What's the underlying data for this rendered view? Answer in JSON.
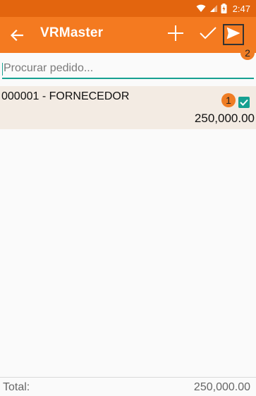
{
  "status_bar": {
    "time": "2:47",
    "icons": [
      "wifi-icon",
      "signal-icon",
      "battery-charging-icon"
    ]
  },
  "app_bar": {
    "title": "VRMaster",
    "actions": [
      "add-icon",
      "check-icon",
      "send-icon"
    ]
  },
  "markers": {
    "m1": "1",
    "m2": "2"
  },
  "search": {
    "placeholder": "Procurar pedido..."
  },
  "orders": [
    {
      "title": "000001 - FORNECEDOR",
      "value": "250,000.00",
      "selected": true
    }
  ],
  "footer": {
    "total_label": "Total:",
    "total_value": "250,000.00"
  },
  "colors": {
    "status_bar": "#e3650e",
    "app_bar": "#f47a20",
    "accent": "#17a091",
    "row_bg": "#f3ebe3",
    "marker": "#ef7d24"
  }
}
